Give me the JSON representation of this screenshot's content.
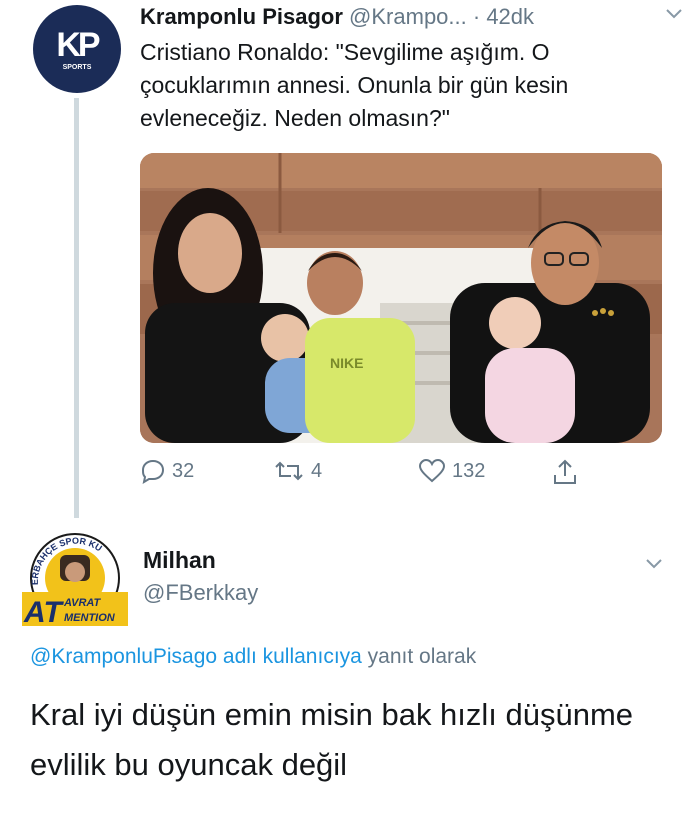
{
  "tweet1": {
    "avatar_text": "KP",
    "avatar_sub": "SPORTS",
    "name": "Kramponlu Pisagor",
    "handle": "@Krampo...",
    "time": "· 42dk",
    "text": "Cristiano Ronaldo: \"Sevgilime aşığım. O çocuklarımın annesi. Onunla bir gün kesin evleneceğiz. Neden olmasın?\"",
    "shirt_text": "NIKE",
    "actions": {
      "reply_count": "32",
      "retweet_count": "4",
      "like_count": "132"
    }
  },
  "tweet2": {
    "name": "Milhan",
    "handle": "@FBerkkay",
    "avatar_ring_text": "ERBAHÇE SPOR KU",
    "avatar_badge_big": "AT",
    "avatar_badge_top": "AVRAT",
    "avatar_badge_bottom": "MENTION",
    "reply_mention": "@KramponluPisago adlı kullanıcıya",
    "reply_suffix": "yanıt olarak",
    "text": "Kral iyi düşün emin misin bak hızlı düşünme evlilik bu oyuncak değil"
  },
  "colors": {
    "avatar1_bg": "#1b2c57",
    "link": "#1b95e0",
    "secondary": "#657786",
    "thread_line": "#cfd9de"
  }
}
